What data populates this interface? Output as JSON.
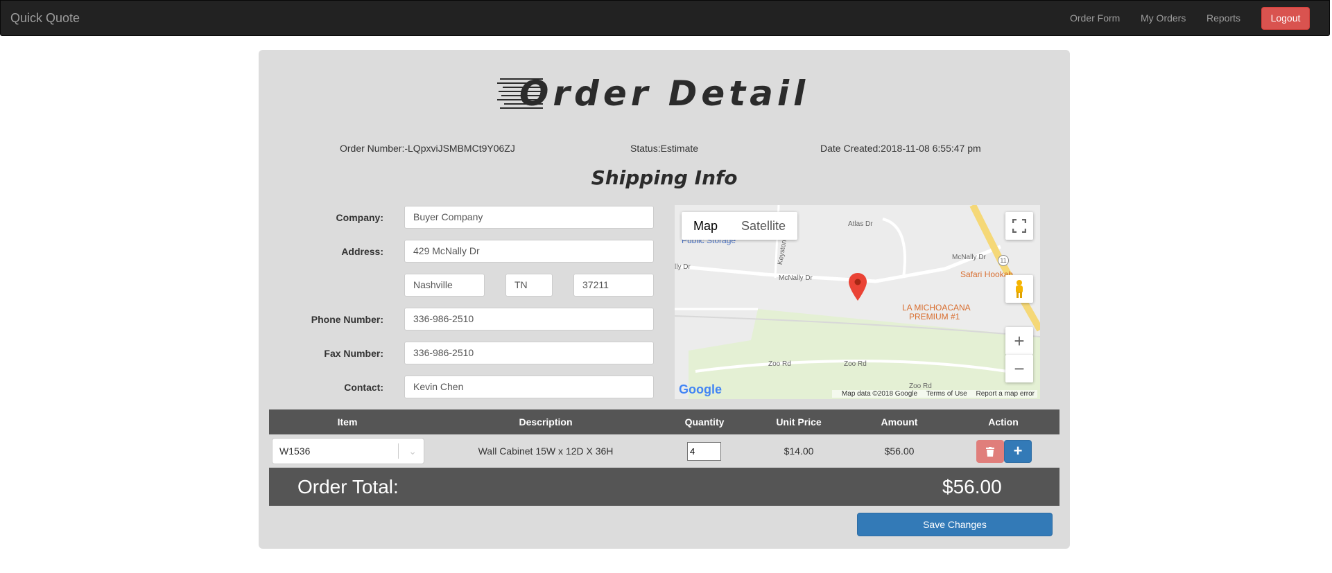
{
  "navbar": {
    "brand": "Quick Quote",
    "links": [
      "Order Form",
      "My Orders",
      "Reports"
    ],
    "logout": "Logout",
    "logout_color": "#d9534f"
  },
  "page": {
    "title": "Order Detail",
    "order_number_label": "Order Number:",
    "order_number": "-LQpxviJSMBMCt9Y06ZJ",
    "status_label": "Status:",
    "status": "Estimate",
    "date_label": "Date Created:",
    "date": "2018-11-08 6:55:47 pm",
    "subtitle": "Shipping Info"
  },
  "shipping": {
    "company_label": "Company:",
    "company": "Buyer Company",
    "address_label": "Address:",
    "address": "429 McNally Dr",
    "city": "Nashville",
    "state": "TN",
    "zip": "37211",
    "phone_label": "Phone Number:",
    "phone": "336-986-2510",
    "fax_label": "Fax Number:",
    "fax": "336-986-2510",
    "contact_label": "Contact:",
    "contact": "Kevin Chen"
  },
  "map": {
    "tab_map": "Map",
    "tab_satellite": "Satellite",
    "google": "Google",
    "footer": [
      "Map data ©2018 Google",
      "Terms of Use",
      "Report a map error"
    ],
    "streets": {
      "atlas": "Atlas Dr",
      "mcnally_left": "McNally Dr",
      "mcnally_right": "McNally Dr",
      "zoo1": "Zoo Rd",
      "zoo2": "Zoo Rd",
      "zoo3": "Zoo Rd",
      "keystone": "Keystone",
      "lly": "lly Dr",
      "route": "11"
    },
    "pois": {
      "public_storage": "Public Storage",
      "safari": "Safari Hookah",
      "la_mich_1": "LA MICHOACANA",
      "la_mich_2": "PREMIUM #1"
    },
    "icons": [
      "fullscreen-icon",
      "pegman-icon",
      "zoom-in-icon",
      "zoom-out-icon",
      "map-marker-icon"
    ]
  },
  "table": {
    "headers": [
      "Item",
      "Description",
      "Quantity",
      "Unit Price",
      "Amount",
      "Action"
    ],
    "rows": [
      {
        "item": "W1536",
        "description": "Wall Cabinet 15W x 12D X 36H",
        "quantity": "4",
        "unit_price": "$14.00",
        "amount": "$56.00"
      }
    ]
  },
  "total": {
    "label": "Order Total:",
    "value": "$56.00"
  },
  "save_label": "Save Changes",
  "colors": {
    "navbar": "#222222",
    "panel": "#dcdcdc",
    "table_header": "#555555",
    "primary": "#337ab7",
    "danger": "#d9534f"
  }
}
